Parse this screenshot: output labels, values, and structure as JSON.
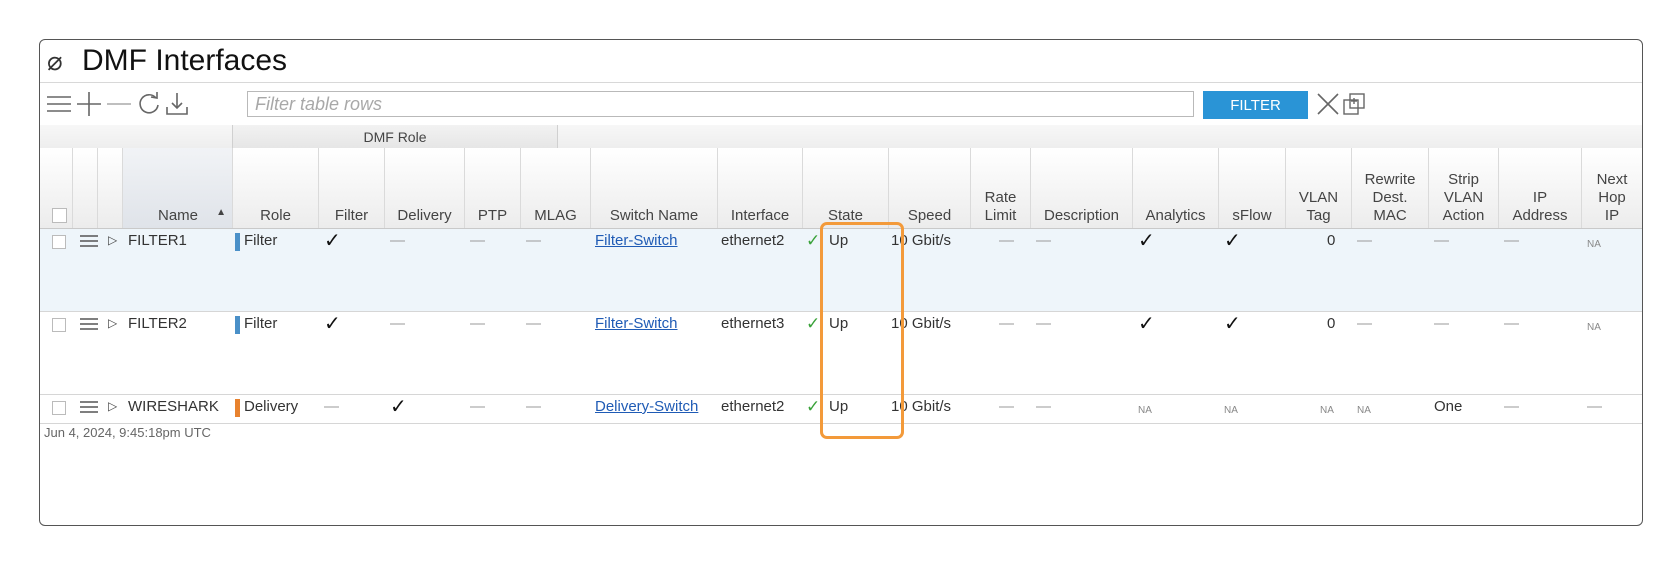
{
  "panel": {
    "title": "DMF Interfaces",
    "title_icon": "disabled-circle-icon"
  },
  "toolbar": {
    "icons": [
      "hamburger-menu-icon",
      "add-icon",
      "remove-icon",
      "refresh-icon",
      "download-icon"
    ],
    "filter_placeholder": "Filter table rows",
    "filter_value": "",
    "filter_button": "FILTER",
    "clear_icon": "close-x-icon",
    "popout_icon": "popout-window-icon"
  },
  "table": {
    "group_header": "DMF Role",
    "columns": {
      "name": "Name",
      "role": "Role",
      "filter": "Filter",
      "delivery": "Delivery",
      "ptp": "PTP",
      "mlag": "MLAG",
      "switch_name": "Switch Name",
      "interface": "Interface",
      "state": "State",
      "speed": "Speed",
      "rate_limit": [
        "Rate",
        "Limit"
      ],
      "description": "Description",
      "analytics": "Analytics",
      "sflow": "sFlow",
      "vlan_tag": [
        "VLAN",
        "Tag"
      ],
      "rewrite": [
        "Rewrite",
        "Dest.",
        "MAC"
      ],
      "strip": [
        "Strip",
        "VLAN",
        "Action"
      ],
      "ip": [
        "IP",
        "Address"
      ],
      "next_hop": [
        "Next",
        "Hop",
        "IP"
      ]
    },
    "rows": [
      {
        "name": "FILTER1",
        "role": "Filter",
        "role_color": "#4a90c8",
        "filter": "✓",
        "delivery": "—",
        "ptp": "—",
        "mlag": "—",
        "switch_name": "Filter-Switch",
        "interface": "ethernet2",
        "state_icon": "✓",
        "state": "Up",
        "speed": "10 Gbit/s",
        "rate_limit": "—",
        "description": "—",
        "analytics": "✓",
        "sflow": "✓",
        "vlan_tag": "0",
        "rewrite": "—",
        "strip": "—",
        "ip": "—",
        "next_hop": "NA"
      },
      {
        "name": "FILTER2",
        "role": "Filter",
        "role_color": "#4a90c8",
        "filter": "✓",
        "delivery": "—",
        "ptp": "—",
        "mlag": "—",
        "switch_name": "Filter-Switch",
        "interface": "ethernet3",
        "state_icon": "✓",
        "state": "Up",
        "speed": "10 Gbit/s",
        "rate_limit": "—",
        "description": "—",
        "analytics": "✓",
        "sflow": "✓",
        "vlan_tag": "0",
        "rewrite": "—",
        "strip": "—",
        "ip": "—",
        "next_hop": "NA"
      },
      {
        "name": "WIRESHARK",
        "role": "Delivery",
        "role_color": "#e8822e",
        "filter": "—",
        "delivery": "✓",
        "ptp": "—",
        "mlag": "—",
        "switch_name": "Delivery-Switch",
        "interface": "ethernet2",
        "state_icon": "✓",
        "state": "Up",
        "speed": "10 Gbit/s",
        "rate_limit": "—",
        "description": "—",
        "analytics": "NA",
        "sflow": "NA",
        "vlan_tag": "NA",
        "rewrite": "NA",
        "strip": "One",
        "ip": "—",
        "next_hop": "—"
      }
    ],
    "timestamp": "Jun 4, 2024, 9:45:18pm UTC"
  },
  "colors": {
    "accent": "#2a94d6",
    "highlight": "#f39a3a",
    "filter_role": "#4a90c8",
    "delivery_role": "#e8822e",
    "state_ok": "#3aa23a",
    "selected_row": "#eef5fa"
  }
}
